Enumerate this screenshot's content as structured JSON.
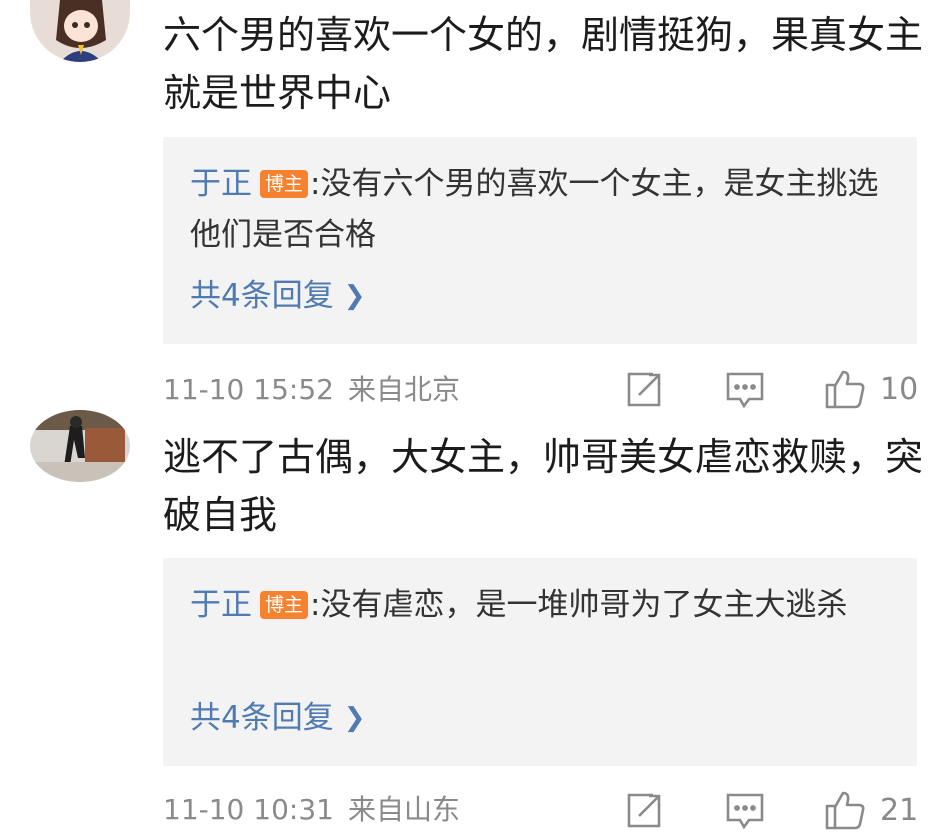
{
  "comments": [
    {
      "text": "六个男的喜欢一个女的，剧情挺狗，果真女主就是世界中心",
      "reply": {
        "author": "于正",
        "badge": "博主",
        "separator": ":",
        "text": "没有六个男的喜欢一个女主，是女主挑选他们是否合格"
      },
      "more_replies": "共4条回复",
      "time": "11-10 15:52",
      "location": "来自北京",
      "likes": "10"
    },
    {
      "text": "逃不了古偶，大女主，帅哥美女虐恋救赎，突破自我",
      "reply": {
        "author": "于正",
        "badge": "博主",
        "separator": ":",
        "text": "没有虐恋，是一堆帅哥为了女主大逃杀"
      },
      "more_replies": "共4条回复",
      "time": "11-10 10:31",
      "location": "来自山东",
      "likes": "21"
    }
  ],
  "icons": {
    "share": "share-icon",
    "comment": "comment-icon",
    "like": "thumbs-up-icon",
    "chevron": "chevron-right-icon"
  },
  "colors": {
    "link": "#4f7bb2",
    "badge": "#f6812f",
    "reply_bg": "#f3f3f3",
    "meta": "#8a8a8a"
  }
}
